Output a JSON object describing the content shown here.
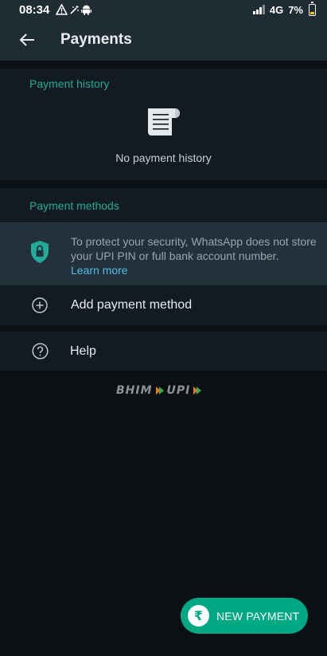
{
  "status_bar": {
    "time": "08:34",
    "network": "4G",
    "battery": "7%"
  },
  "app_bar": {
    "title": "Payments"
  },
  "payment_history": {
    "label": "Payment history",
    "empty_text": "No payment history"
  },
  "payment_methods": {
    "label": "Payment methods",
    "security_note": "To protect your security, WhatsApp does not store your UPI PIN or full bank account number.",
    "learn_more": "Learn more",
    "add_method_label": "Add payment method"
  },
  "help": {
    "label": "Help"
  },
  "branding": {
    "bhim": "BHIM",
    "upi": "UPI"
  },
  "fab": {
    "icon_glyph": "₹",
    "label": "NEW PAYMENT"
  },
  "colors": {
    "accent": "#00a884",
    "section_label": "#25a99a",
    "link": "#53bdeb",
    "app_bar": "#1f2c34",
    "background": "#0b1014"
  }
}
